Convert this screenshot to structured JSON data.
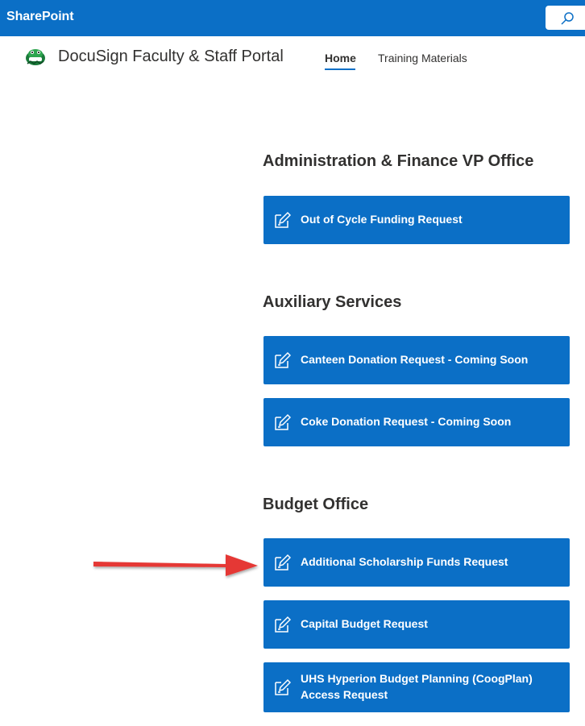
{
  "suitebar": {
    "brand": "SharePoint",
    "color": "#0b6fc6"
  },
  "header": {
    "title": "DocuSign Faculty & Staff Portal",
    "nav": {
      "home": "Home",
      "training": "Training Materials"
    }
  },
  "sections": [
    {
      "title": "Administration & Finance VP Office",
      "buttons": [
        "Out of Cycle Funding Request"
      ]
    },
    {
      "title": "Auxiliary Services",
      "buttons": [
        "Canteen Donation Request - Coming Soon",
        "Coke Donation Request - Coming Soon"
      ]
    },
    {
      "title": "Budget Office",
      "buttons": [
        "Additional Scholarship Funds Request",
        "Capital Budget Request",
        "UHS Hyperion Budget Planning (CoogPlan) Access Request"
      ]
    }
  ],
  "annotation": {
    "arrow_color": "#e53935",
    "icon": "arrow-right-icon"
  },
  "icons": {
    "search": "search-icon",
    "form": "form-edit-icon",
    "logo": "mascot-logo-icon"
  }
}
